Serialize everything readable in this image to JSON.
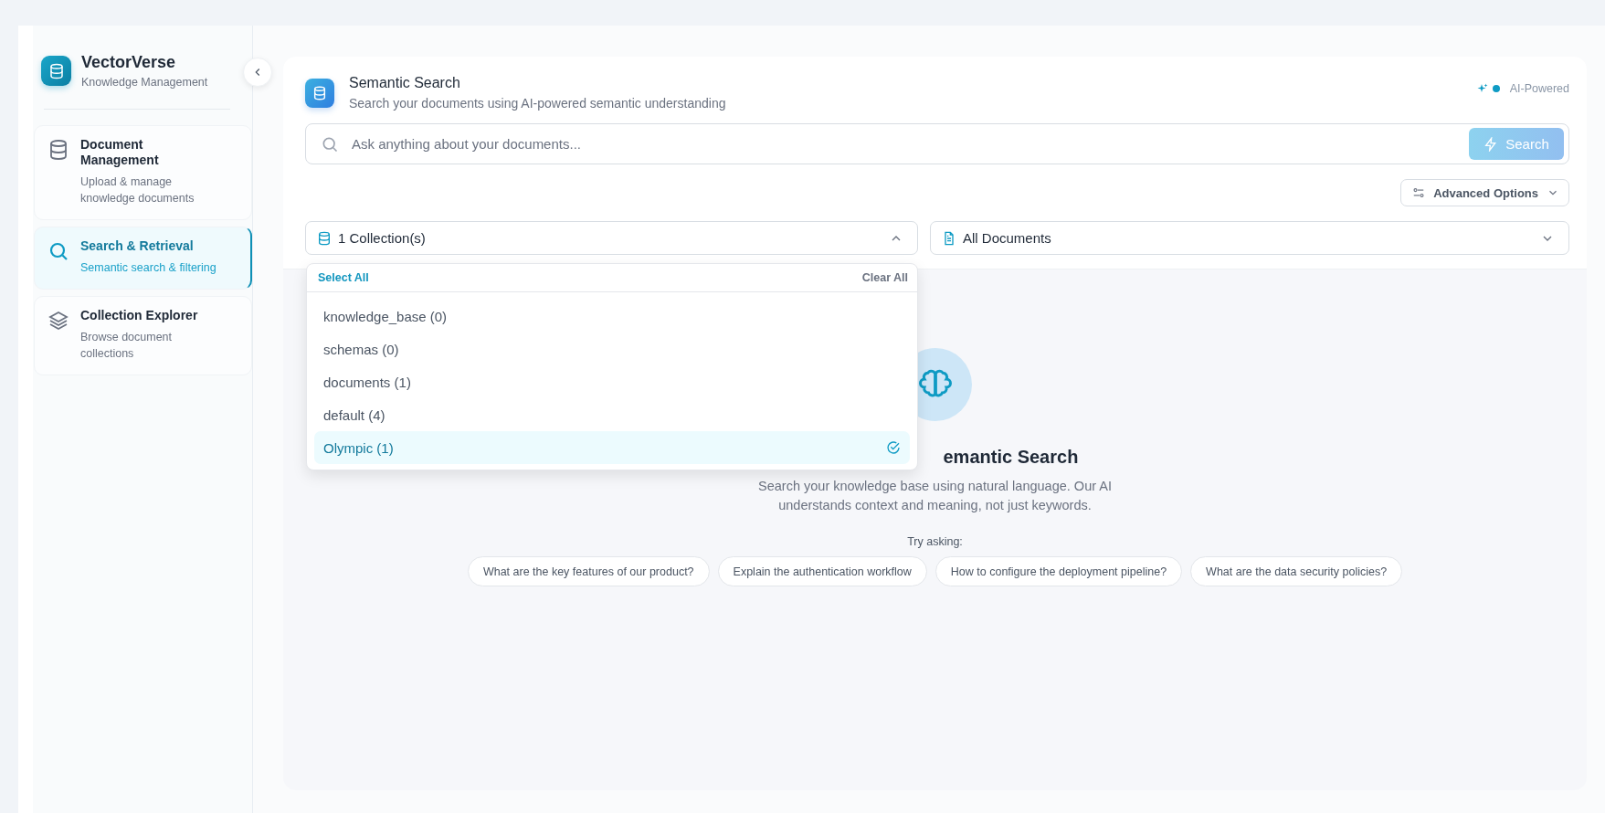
{
  "sidebar": {
    "brand": {
      "title": "VectorVerse",
      "subtitle": "Knowledge Management"
    },
    "items": [
      {
        "title": "Document Management",
        "subtitle": "Upload & manage knowledge documents",
        "selected": false
      },
      {
        "title": "Search & Retrieval",
        "subtitle": "Semantic search & filtering",
        "selected": true
      },
      {
        "title": "Collection Explorer",
        "subtitle": "Browse document collections",
        "selected": false
      }
    ]
  },
  "header": {
    "title": "Semantic Search",
    "subtitle": "Search your documents using AI-powered semantic understanding",
    "badge": "AI-Powered"
  },
  "search": {
    "placeholder": "Ask anything about your documents...",
    "button": "Search"
  },
  "advanced_options": "Advanced Options",
  "collection_select": {
    "value": "1 Collection(s)",
    "expanded": true
  },
  "document_select": {
    "value": "All Documents"
  },
  "dropdown": {
    "select_all": "Select All",
    "clear_all": "Clear All",
    "items": [
      {
        "label": "knowledge_base (0)",
        "selected": false
      },
      {
        "label": "schemas (0)",
        "selected": false
      },
      {
        "label": "documents (1)",
        "selected": false
      },
      {
        "label": "default (4)",
        "selected": false
      },
      {
        "label": "Olympic (1)",
        "selected": true
      }
    ]
  },
  "empty_state": {
    "title": "emantic Search",
    "description": "Search your knowledge base using natural language. Our AI understands context and meaning, not just keywords.",
    "try_label": "Try asking:",
    "suggestions": [
      "What are the key features of our product?",
      "Explain the authentication workflow",
      "How to configure the deployment pipeline?",
      "What are the data security policies?"
    ]
  }
}
